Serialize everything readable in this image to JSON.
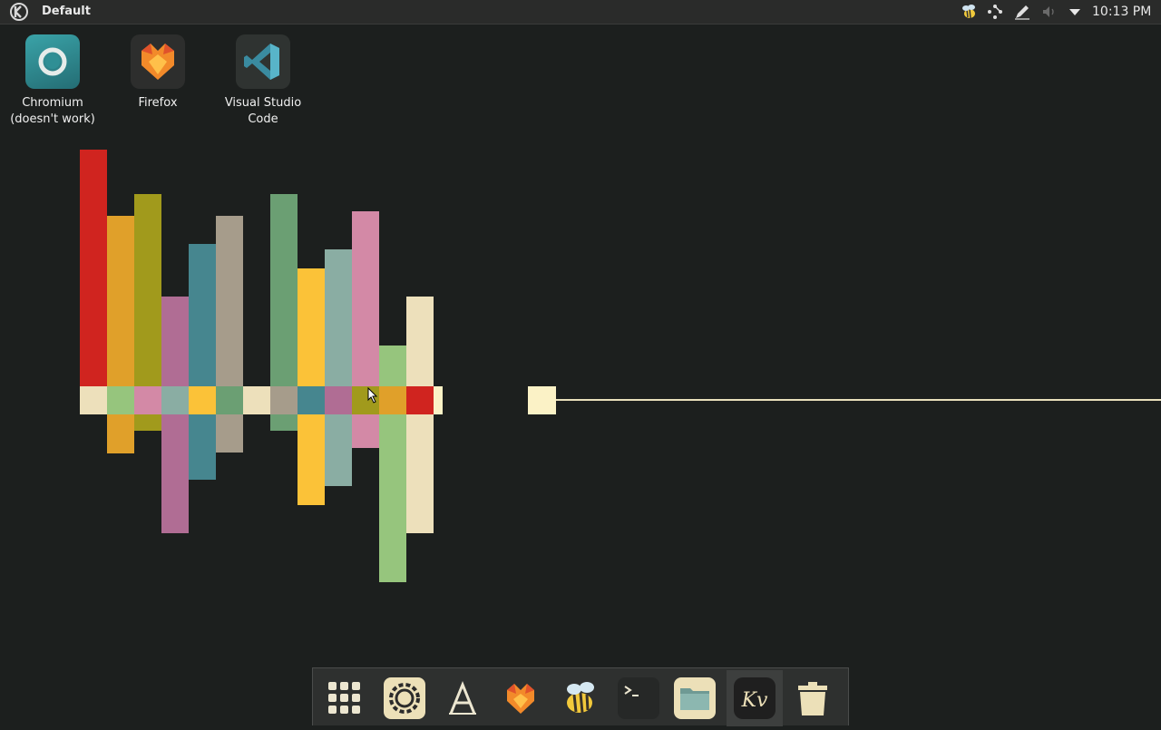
{
  "panel": {
    "activity_title": "Default",
    "clock": "10:13 PM"
  },
  "desktop_icons": [
    {
      "label": "Chromium\n(doesn't work)",
      "line1": "Chromium",
      "line2": "(doesn't work)",
      "icon": "chromium-icon"
    },
    {
      "label": "Firefox",
      "line1": "Firefox",
      "line2": "",
      "icon": "firefox-icon"
    },
    {
      "label": "Visual Studio Code",
      "line1": "Visual Studio",
      "line2": "Code",
      "icon": "vscode-icon"
    }
  ],
  "tray_icons": [
    "bee-icon",
    "network-icon",
    "pen-icon",
    "volume-icon",
    "expand-arrow-icon"
  ],
  "dock_items": [
    {
      "icon": "app-grid-icon"
    },
    {
      "icon": "settings-gear-icon"
    },
    {
      "icon": "text-font-icon"
    },
    {
      "icon": "firefox-icon"
    },
    {
      "icon": "bee-icon"
    },
    {
      "icon": "terminal-icon"
    },
    {
      "icon": "folder-icon"
    },
    {
      "icon": "kv-icon",
      "active": true
    },
    {
      "icon": "trash-icon"
    }
  ],
  "colors": {
    "background": "#1c1f1e",
    "panel": "#2a2b2a",
    "line": "#e9dfbb"
  }
}
